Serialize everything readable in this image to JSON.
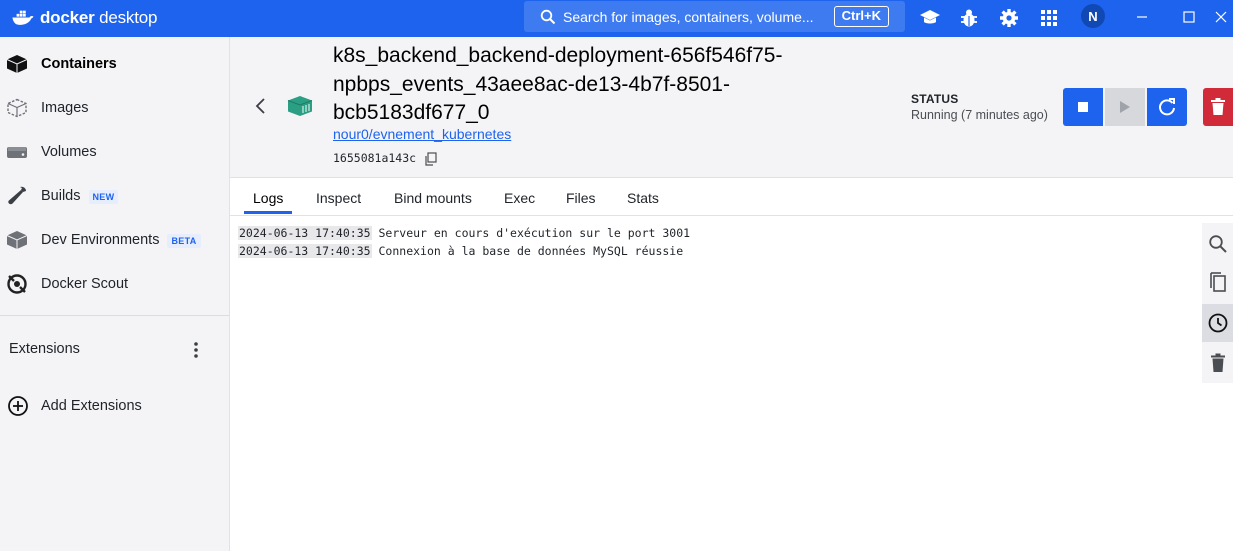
{
  "app": {
    "brand_bold": "docker",
    "brand_light": " desktop"
  },
  "topbar": {
    "search_placeholder": "Search for images, containers, volume...",
    "search_shortcut": "Ctrl+K",
    "avatar_initial": "N",
    "icons": [
      "learning-center-icon",
      "bug-icon",
      "settings-icon",
      "apps-grid-icon"
    ]
  },
  "sidebar": {
    "items": [
      {
        "label": "Containers",
        "icon": "containers-icon",
        "active": true,
        "badge": ""
      },
      {
        "label": "Images",
        "icon": "images-icon",
        "active": false,
        "badge": ""
      },
      {
        "label": "Volumes",
        "icon": "volumes-icon",
        "active": false,
        "badge": ""
      },
      {
        "label": "Builds",
        "icon": "builds-icon",
        "active": false,
        "badge": "NEW"
      },
      {
        "label": "Dev Environments",
        "icon": "dev-environments-icon",
        "active": false,
        "badge": "BETA"
      },
      {
        "label": "Docker Scout",
        "icon": "docker-scout-icon",
        "active": false,
        "badge": ""
      }
    ],
    "extensions_label": "Extensions",
    "add_extensions_label": "Add Extensions"
  },
  "container": {
    "title_lines": [
      "k8s_backend_backend-deployment-656f546f75-",
      "npbps_events_43aee8ac-de13-4b7f-8501-",
      "bcb5183df677_0"
    ],
    "image": "nour0/evnement_kubernetes",
    "id": "1655081a143c",
    "status_label": "STATUS",
    "status_value": "Running (7 minutes ago)"
  },
  "tabs": [
    {
      "label": "Logs",
      "active": true
    },
    {
      "label": "Inspect",
      "active": false
    },
    {
      "label": "Bind mounts",
      "active": false
    },
    {
      "label": "Exec",
      "active": false
    },
    {
      "label": "Files",
      "active": false
    },
    {
      "label": "Stats",
      "active": false
    }
  ],
  "logs": [
    {
      "timestamp": "2024-06-13 17:40:35",
      "message": "Serveur en cours d'exécution sur le port 3001"
    },
    {
      "timestamp": "2024-06-13 17:40:35",
      "message": "Connexion à la base de données MySQL réussie"
    }
  ],
  "colors": {
    "accent": "#1d63ed",
    "danger": "#d12b3a",
    "container_icon": "#2b9f83"
  }
}
